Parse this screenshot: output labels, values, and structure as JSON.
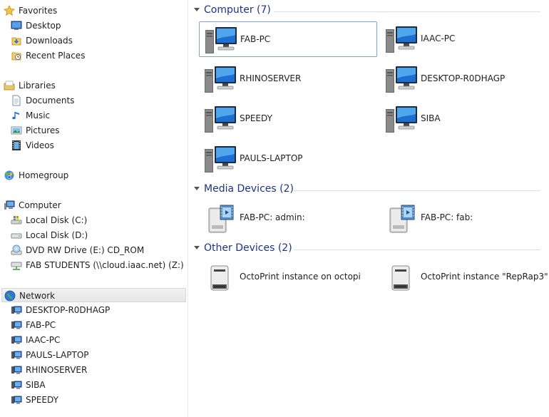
{
  "nav": {
    "favorites": {
      "label": "Favorites",
      "items": [
        {
          "label": "Desktop"
        },
        {
          "label": "Downloads"
        },
        {
          "label": "Recent Places"
        }
      ]
    },
    "libraries": {
      "label": "Libraries",
      "items": [
        {
          "label": "Documents"
        },
        {
          "label": "Music"
        },
        {
          "label": "Pictures"
        },
        {
          "label": "Videos"
        }
      ]
    },
    "homegroup": {
      "label": "Homegroup"
    },
    "computer": {
      "label": "Computer",
      "items": [
        {
          "label": "Local Disk (C:)"
        },
        {
          "label": "Local Disk (D:)"
        },
        {
          "label": "DVD RW Drive (E:) CD_ROM"
        },
        {
          "label": "FAB STUDENTS (\\\\cloud.iaac.net) (Z:)"
        }
      ]
    },
    "network": {
      "label": "Network",
      "items": [
        {
          "label": "DESKTOP-R0DHAGP"
        },
        {
          "label": "FAB-PC"
        },
        {
          "label": "IAAC-PC"
        },
        {
          "label": "PAULS-LAPTOP"
        },
        {
          "label": "RHINOSERVER"
        },
        {
          "label": "SIBA"
        },
        {
          "label": "SPEEDY"
        }
      ]
    }
  },
  "content": {
    "computer_group": {
      "title": "Computer (7)",
      "items": [
        {
          "label": "FAB-PC"
        },
        {
          "label": "IAAC-PC"
        },
        {
          "label": "RHINOSERVER"
        },
        {
          "label": "DESKTOP-R0DHAGP"
        },
        {
          "label": "SPEEDY"
        },
        {
          "label": "SIBA"
        },
        {
          "label": "PAULS-LAPTOP"
        }
      ]
    },
    "media_group": {
      "title": "Media Devices (2)",
      "items": [
        {
          "label": "FAB-PC: admin:"
        },
        {
          "label": "FAB-PC: fab:"
        }
      ]
    },
    "other_group": {
      "title": "Other Devices (2)",
      "items": [
        {
          "label": "OctoPrint instance on octopi"
        },
        {
          "label": "OctoPrint instance \"RepRap3\""
        }
      ]
    }
  },
  "colors": {
    "accent": "#1e3287",
    "selection_border": "#7da2ce",
    "header_rule": "#d8e0ea"
  }
}
